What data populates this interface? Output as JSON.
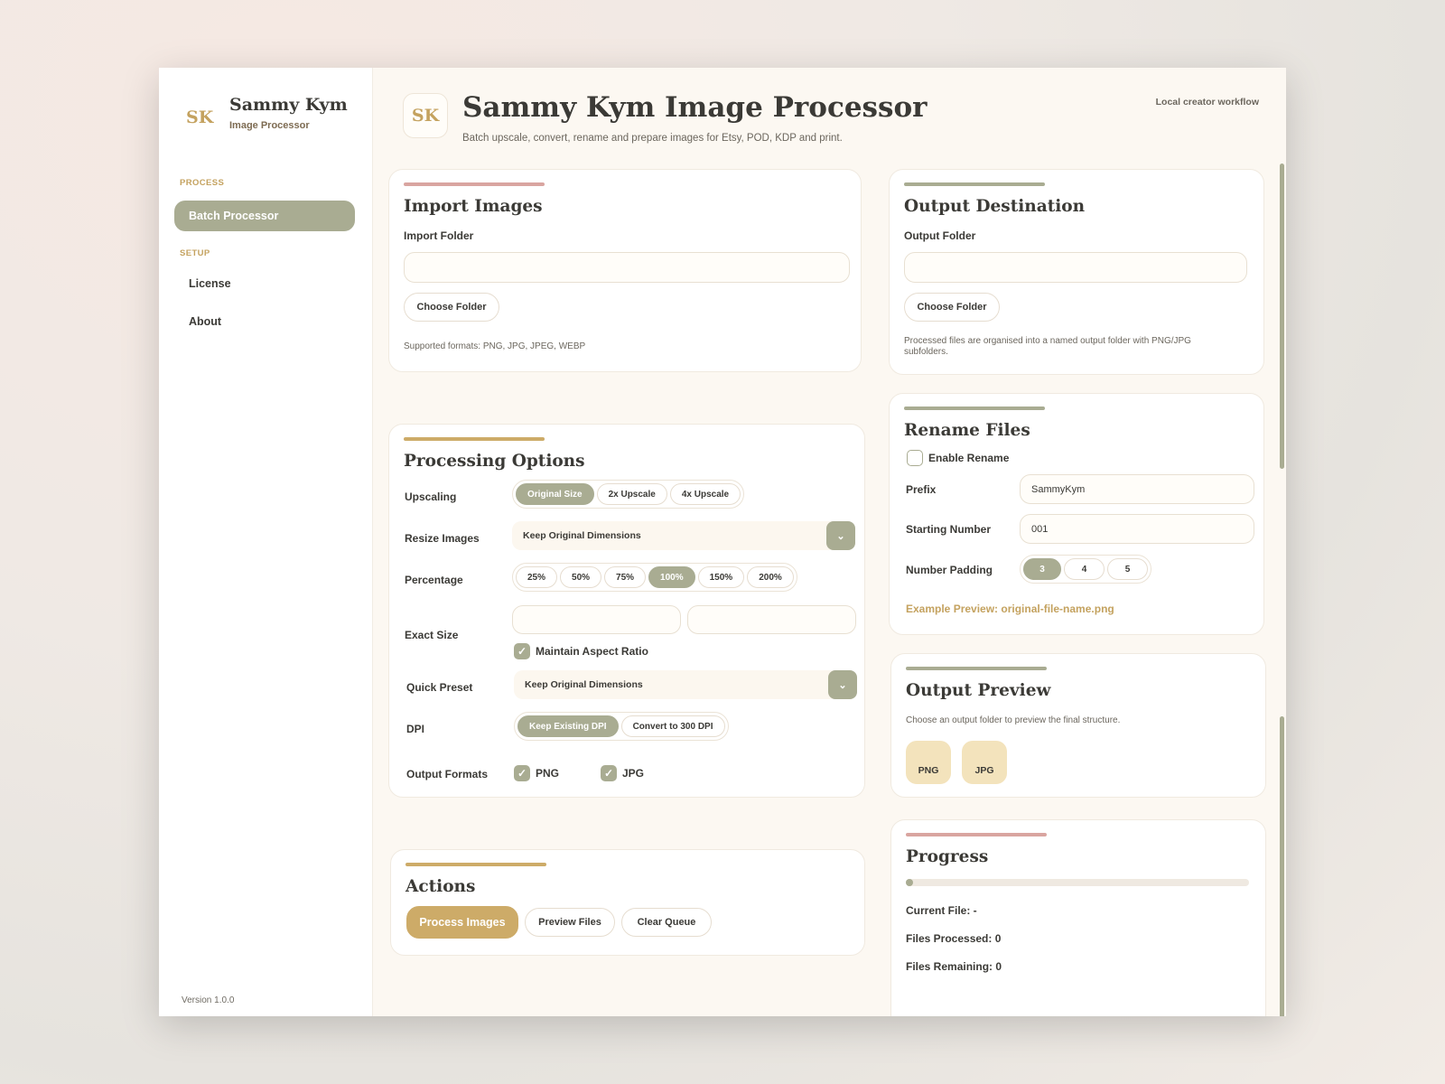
{
  "sidebar": {
    "brand_mark": "SK",
    "brand_name": "Sammy Kym",
    "brand_sub": "Image Processor",
    "section_process": "PROCESS",
    "section_setup": "SETUP",
    "items": [
      {
        "label": "Batch Processor",
        "active": true
      },
      {
        "label": "License",
        "active": false
      },
      {
        "label": "About",
        "active": false
      }
    ],
    "version": "Version 1.0.0"
  },
  "header": {
    "logo": "SK",
    "title": "Sammy Kym Image Processor",
    "subtitle": "Batch upscale, convert, rename and prepare images for Etsy, POD, KDP and print.",
    "workflow": "Local creator workflow"
  },
  "import": {
    "title": "Import Images",
    "folder_label": "Import Folder",
    "folder_value": "",
    "choose_label": "Choose Folder",
    "hint": "Supported formats: PNG, JPG, JPEG, WEBP"
  },
  "output_destination": {
    "title": "Output Destination",
    "folder_label": "Output Folder",
    "folder_value": "",
    "choose_label": "Choose Folder",
    "hint": "Processed files are organised into a named output folder with PNG/JPG subfolders."
  },
  "processing": {
    "title": "Processing Options",
    "upscaling_label": "Upscaling",
    "upscaling_options": [
      "Original Size",
      "2x Upscale",
      "4x Upscale"
    ],
    "upscaling_selected": "Original Size",
    "resize_label": "Resize Images",
    "resize_value": "Keep Original Dimensions",
    "percentage_label": "Percentage",
    "percentage_options": [
      "25%",
      "50%",
      "75%",
      "100%",
      "150%",
      "200%"
    ],
    "percentage_selected": "100%",
    "exact_label": "Exact Size",
    "exact_width": "",
    "exact_height": "",
    "aspect_label": "Maintain Aspect Ratio",
    "aspect_checked": true,
    "preset_label": "Quick Preset",
    "preset_value": "Keep Original Dimensions",
    "dpi_label": "DPI",
    "dpi_options": [
      "Keep Existing DPI",
      "Convert to 300 DPI"
    ],
    "dpi_selected": "Keep Existing DPI",
    "formats_label": "Output Formats",
    "format_png": "PNG",
    "format_jpg": "JPG",
    "png_checked": true,
    "jpg_checked": true
  },
  "actions": {
    "title": "Actions",
    "process_label": "Process Images",
    "preview_label": "Preview Files",
    "clear_label": "Clear Queue"
  },
  "rename": {
    "title": "Rename Files",
    "enable_label": "Enable Rename",
    "enable_checked": false,
    "prefix_label": "Prefix",
    "prefix_value": "SammyKym",
    "start_label": "Starting Number",
    "start_value": "001",
    "padding_label": "Number Padding",
    "padding_options": [
      "3",
      "4",
      "5"
    ],
    "padding_selected": "3",
    "example": "Example Preview: original-file-name.png"
  },
  "output_preview": {
    "title": "Output Preview",
    "hint": "Choose an output folder to preview the final structure.",
    "chips": [
      "PNG",
      "JPG"
    ]
  },
  "progress": {
    "title": "Progress",
    "fraction": 0.02,
    "current_file": "Current File: -",
    "processed": "Files Processed: 0",
    "remaining": "Files Remaining: 0"
  },
  "colors": {
    "sage": "#a9ac92",
    "gold": "#cdab68",
    "rose": "#d9a5a0",
    "cream": "#fcf8f2"
  },
  "icons": {
    "dropdown": "chevron-down-icon",
    "check": "check-icon"
  }
}
